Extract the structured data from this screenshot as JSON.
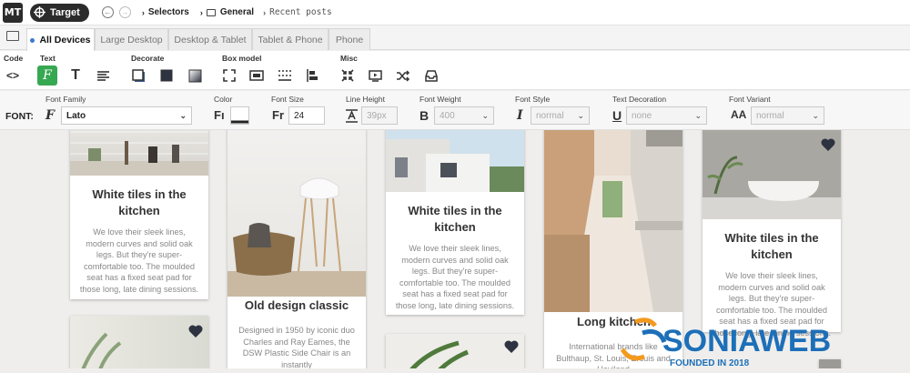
{
  "app": {
    "logo": "MT",
    "target_label": "Target"
  },
  "breadcrumb": {
    "item1": "Selectors",
    "item2": "General",
    "item3": "Recent posts"
  },
  "tabs": [
    "All Devices",
    "Large Desktop",
    "Desktop & Tablet",
    "Tablet & Phone",
    "Phone"
  ],
  "toolbar": {
    "groups": {
      "code": "Code",
      "text": "Text",
      "decorate": "Decorate",
      "box_model": "Box model",
      "misc": "Misc"
    }
  },
  "fontbar": {
    "section_label": "FONT:",
    "labels": {
      "family": "Font Family",
      "color": "Color",
      "size": "Font Size",
      "line_height": "Line Height",
      "weight": "Font Weight",
      "style": "Font Style",
      "decoration": "Text Decoration",
      "variant": "Font Variant"
    },
    "family_value": "Lato",
    "size_value": "24",
    "line_height_placeholder": "39px",
    "weight_value": "400",
    "style_value": "normal",
    "decoration_value": "none",
    "variant_value": "normal"
  },
  "cards": {
    "c1": {
      "title": "White tiles in the kitchen",
      "body": "We love their sleek lines, modern curves and solid oak legs. But they're super-comfortable too. The moulded seat has a fixed seat pad for those long, late dining sessions."
    },
    "c2": {
      "title": "Old design classic",
      "body": "Designed in 1950 by iconic duo Charles and Ray Eames, the DSW Plastic Side Chair is an instantly"
    },
    "c3": {
      "title": "White tiles in the kitchen",
      "body": "We love their sleek lines, modern curves and solid oak legs. But they're super-comfortable too. The moulded seat has a fixed seat pad for those long, late dining sessions."
    },
    "c4": {
      "title": "Long kitchen",
      "body": "International brands like Bulthaup, St. Louis, Ercuis and Haviland"
    },
    "c5": {
      "title": "White tiles in the kitchen",
      "body": "We love their sleek lines, modern curves and solid oak legs. But they're super-comfortable too. The moulded seat has a fixed seat pad for those long, late dining sessions."
    }
  },
  "watermark": {
    "brand": "SONIAWEB",
    "tagline": "FOUNDED IN 2018"
  },
  "colors": {
    "accent_green": "#36a852",
    "tab_dot": "#3b7ad0",
    "watermark_blue": "#1d6fb8",
    "watermark_orange": "#f39a1e"
  }
}
